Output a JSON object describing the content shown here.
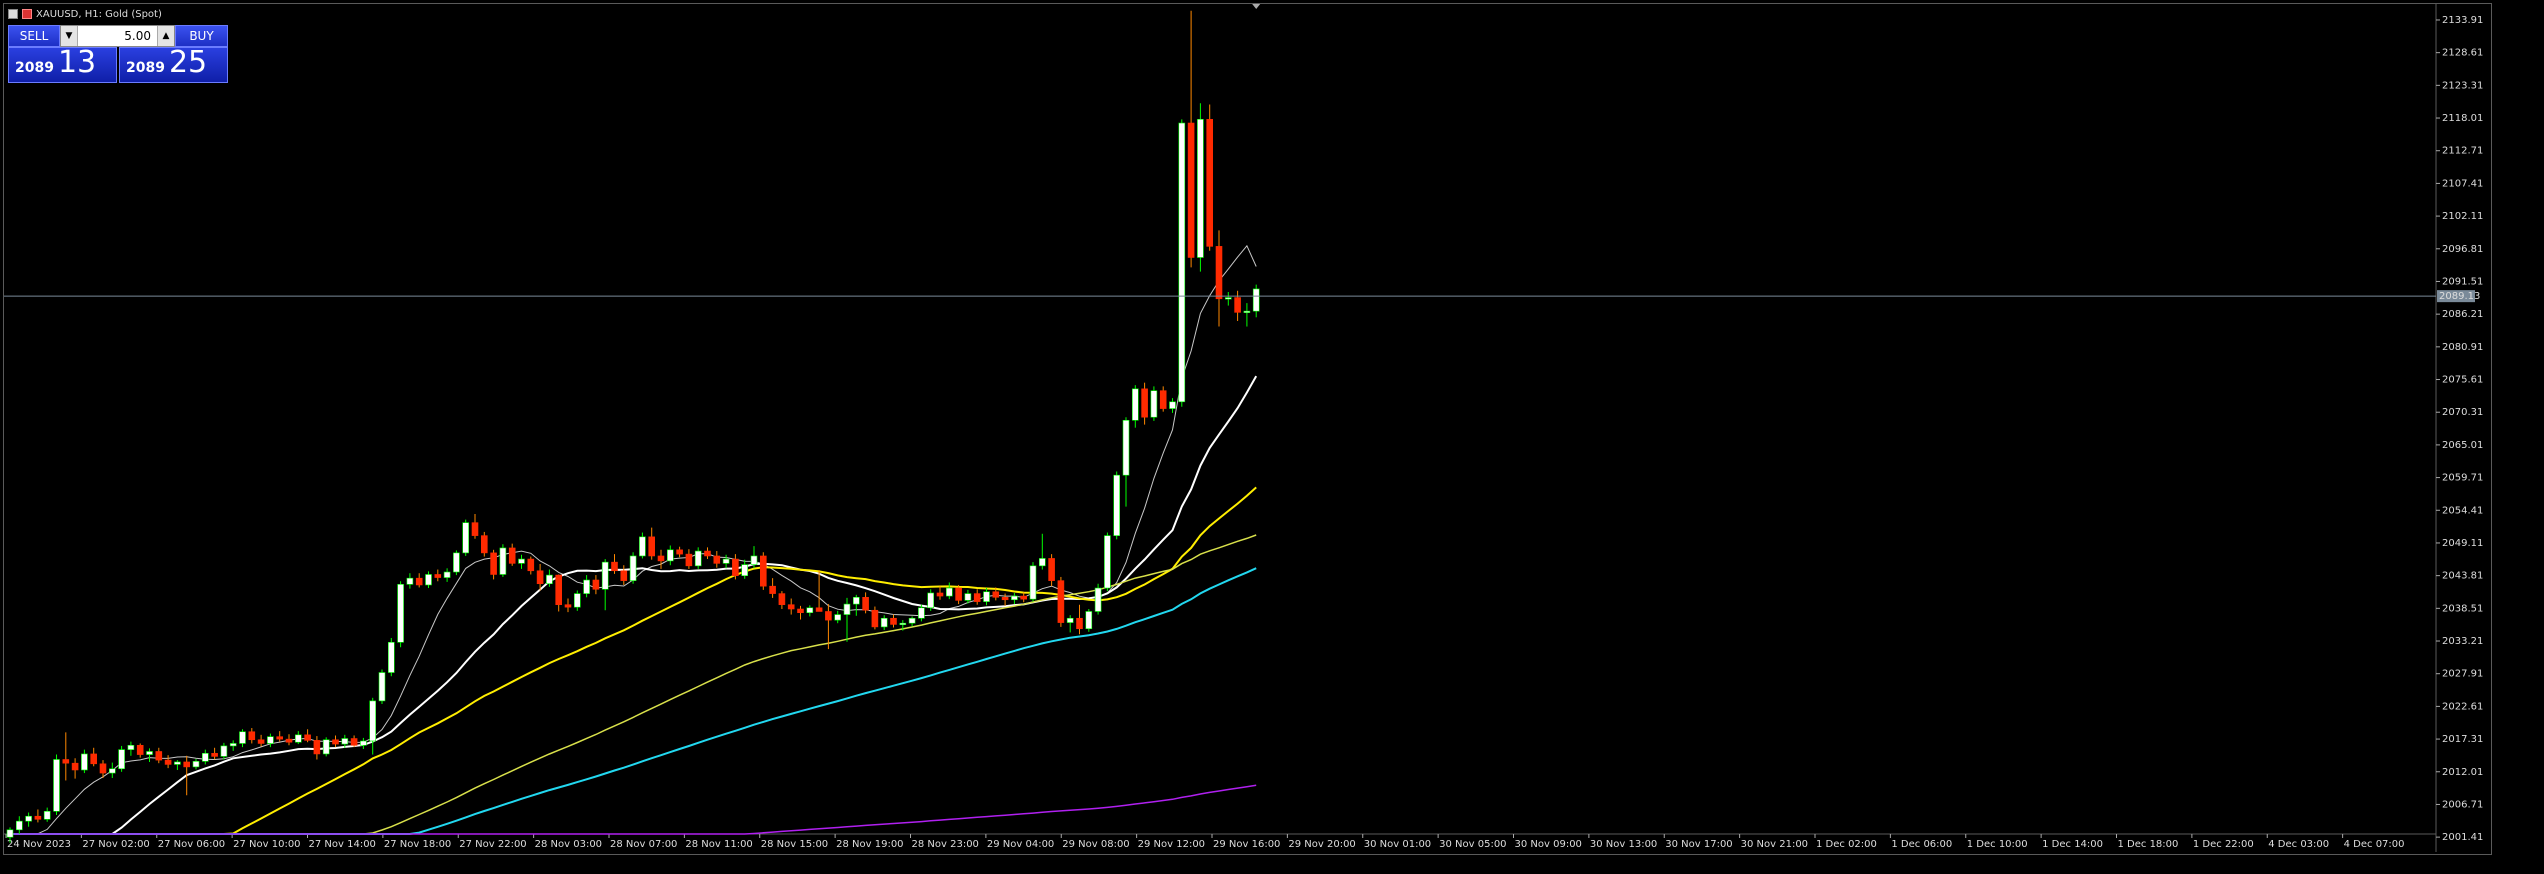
{
  "window": {
    "title": "XAUUSD, H1:  Gold (Spot)"
  },
  "trade_panel": {
    "sell_label": "SELL",
    "buy_label": "BUY",
    "lot": "5.00",
    "sell_price_small": "2089",
    "sell_price_big": "13",
    "buy_price_small": "2089",
    "buy_price_big": "25"
  },
  "colors": {
    "background": "#000000",
    "bull_body": "#ffffff",
    "bear_body": "#ff2a00",
    "wick_bull": "#00ff00",
    "wick_bear": "#ff8800",
    "ma_fast": "#c8c8c8",
    "ma_white": "#ffffff",
    "ma_yellow": "#ffee00",
    "ma_olive": "#d8e04a",
    "ma_cyan": "#22d8f0",
    "ma_purple": "#b020f0",
    "bid_line": "#7a8a99"
  },
  "chart_data": {
    "type": "candlestick",
    "symbol": "XAUUSD",
    "timeframe": "H1",
    "current_price_label": "2089.13",
    "current_price": 2089.13,
    "price_ticks": [
      "2133.91",
      "2128.61",
      "2123.31",
      "2118.01",
      "2112.71",
      "2107.41",
      "2102.11",
      "2096.81",
      "2091.51",
      "2086.21",
      "2080.91",
      "2075.61",
      "2070.31",
      "2065.01",
      "2059.71",
      "2054.41",
      "2049.11",
      "2043.81",
      "2038.51",
      "2033.21",
      "2027.91",
      "2022.61",
      "2017.31",
      "2012.01",
      "2006.71",
      "2001.41"
    ],
    "time_ticks": [
      "24 Nov 2023",
      "27 Nov 02:00",
      "27 Nov 06:00",
      "27 Nov 10:00",
      "27 Nov 14:00",
      "27 Nov 18:00",
      "27 Nov 22:00",
      "28 Nov 03:00",
      "28 Nov 07:00",
      "28 Nov 11:00",
      "28 Nov 15:00",
      "28 Nov 19:00",
      "28 Nov 23:00",
      "29 Nov 04:00",
      "29 Nov 08:00",
      "29 Nov 12:00",
      "29 Nov 16:00",
      "29 Nov 20:00",
      "30 Nov 01:00",
      "30 Nov 05:00",
      "30 Nov 09:00",
      "30 Nov 13:00",
      "30 Nov 17:00",
      "30 Nov 21:00",
      "1 Dec 02:00",
      "1 Dec 06:00",
      "1 Dec 10:00",
      "1 Dec 14:00",
      "1 Dec 18:00",
      "1 Dec 22:00",
      "4 Dec 03:00",
      "4 Dec 07:00"
    ],
    "ylim": [
      1999.0,
      2136.5
    ],
    "candles": [
      [
        2001.4,
        2003.0,
        2000.5,
        2002.6
      ],
      [
        2002.6,
        2004.8,
        2001.9,
        2004.0
      ],
      [
        2004.0,
        2005.4,
        2003.1,
        2004.8
      ],
      [
        2004.8,
        2005.9,
        2003.8,
        2004.3
      ],
      [
        2004.3,
        2006.2,
        2003.9,
        2005.6
      ],
      [
        2005.6,
        2014.8,
        2005.0,
        2014.0
      ],
      [
        2014.0,
        2018.4,
        2010.6,
        2013.4
      ],
      [
        2013.4,
        2014.2,
        2010.9,
        2012.3
      ],
      [
        2012.3,
        2015.6,
        2011.8,
        2014.9
      ],
      [
        2014.9,
        2015.9,
        2012.9,
        2013.3
      ],
      [
        2013.3,
        2013.9,
        2011.0,
        2011.8
      ],
      [
        2011.8,
        2013.5,
        2011.0,
        2012.5
      ],
      [
        2012.5,
        2016.2,
        2012.0,
        2015.6
      ],
      [
        2015.6,
        2016.9,
        2014.6,
        2016.3
      ],
      [
        2016.3,
        2016.6,
        2014.3,
        2014.8
      ],
      [
        2014.8,
        2015.8,
        2013.6,
        2015.3
      ],
      [
        2015.3,
        2015.9,
        2013.4,
        2013.9
      ],
      [
        2013.9,
        2014.7,
        2012.6,
        2013.2
      ],
      [
        2013.2,
        2013.9,
        2012.3,
        2013.6
      ],
      [
        2013.6,
        2014.6,
        2008.2,
        2012.8
      ],
      [
        2012.8,
        2014.1,
        2012.4,
        2013.7
      ],
      [
        2013.7,
        2015.6,
        2013.2,
        2015.0
      ],
      [
        2015.0,
        2015.9,
        2014.0,
        2014.5
      ],
      [
        2014.5,
        2016.7,
        2014.0,
        2016.2
      ],
      [
        2016.2,
        2017.1,
        2015.4,
        2016.6
      ],
      [
        2016.6,
        2018.9,
        2016.0,
        2018.5
      ],
      [
        2018.5,
        2019.1,
        2016.6,
        2017.2
      ],
      [
        2017.2,
        2018.0,
        2016.1,
        2016.6
      ],
      [
        2016.6,
        2018.2,
        2016.0,
        2017.7
      ],
      [
        2017.7,
        2018.6,
        2016.9,
        2017.3
      ],
      [
        2017.3,
        2018.1,
        2016.3,
        2016.8
      ],
      [
        2016.8,
        2018.6,
        2016.5,
        2018.0
      ],
      [
        2018.0,
        2018.9,
        2016.8,
        2017.1
      ],
      [
        2017.1,
        2017.8,
        2014.0,
        2014.9
      ],
      [
        2014.9,
        2017.6,
        2014.5,
        2017.2
      ],
      [
        2017.2,
        2017.9,
        2016.0,
        2016.5
      ],
      [
        2016.5,
        2018.0,
        2015.9,
        2017.4
      ],
      [
        2017.4,
        2017.9,
        2016.0,
        2016.3
      ],
      [
        2016.3,
        2017.5,
        2015.7,
        2017.0
      ],
      [
        2017.0,
        2024.0,
        2014.8,
        2023.5
      ],
      [
        2023.5,
        2028.6,
        2023.0,
        2028.1
      ],
      [
        2028.1,
        2033.7,
        2027.5,
        2033.0
      ],
      [
        2033.0,
        2042.9,
        2032.2,
        2042.4
      ],
      [
        2042.4,
        2044.2,
        2041.7,
        2043.4
      ],
      [
        2043.4,
        2044.2,
        2041.9,
        2042.3
      ],
      [
        2042.3,
        2044.5,
        2041.8,
        2044.0
      ],
      [
        2044.0,
        2044.8,
        2042.9,
        2043.5
      ],
      [
        2043.5,
        2045.0,
        2042.8,
        2044.4
      ],
      [
        2044.4,
        2047.9,
        2043.9,
        2047.5
      ],
      [
        2047.5,
        2052.9,
        2047.0,
        2052.4
      ],
      [
        2052.4,
        2053.8,
        2049.8,
        2050.3
      ],
      [
        2050.3,
        2050.9,
        2046.9,
        2047.5
      ],
      [
        2047.5,
        2048.0,
        2043.2,
        2044.0
      ],
      [
        2044.0,
        2048.9,
        2043.6,
        2048.3
      ],
      [
        2048.3,
        2049.0,
        2045.4,
        2045.8
      ],
      [
        2045.8,
        2047.2,
        2044.9,
        2046.5
      ],
      [
        2046.5,
        2046.9,
        2044.0,
        2044.6
      ],
      [
        2044.6,
        2045.7,
        2041.4,
        2042.5
      ],
      [
        2042.5,
        2044.8,
        2042.0,
        2043.9
      ],
      [
        2043.9,
        2044.0,
        2038.0,
        2039.1
      ],
      [
        2039.1,
        2040.1,
        2037.9,
        2038.7
      ],
      [
        2038.7,
        2041.4,
        2038.1,
        2040.9
      ],
      [
        2040.9,
        2043.9,
        2040.3,
        2043.1
      ],
      [
        2043.1,
        2043.9,
        2040.8,
        2041.6
      ],
      [
        2041.6,
        2046.5,
        2038.2,
        2046.0
      ],
      [
        2046.0,
        2047.3,
        2044.1,
        2044.6
      ],
      [
        2044.6,
        2045.5,
        2042.3,
        2043.0
      ],
      [
        2043.0,
        2047.6,
        2042.5,
        2047.0
      ],
      [
        2047.0,
        2050.8,
        2046.6,
        2050.1
      ],
      [
        2050.1,
        2051.6,
        2046.4,
        2047.0
      ],
      [
        2047.0,
        2048.0,
        2044.9,
        2046.2
      ],
      [
        2046.2,
        2048.7,
        2045.5,
        2048.0
      ],
      [
        2048.0,
        2048.5,
        2046.8,
        2047.3
      ],
      [
        2047.3,
        2048.1,
        2044.9,
        2045.4
      ],
      [
        2045.4,
        2048.4,
        2044.9,
        2047.8
      ],
      [
        2047.8,
        2048.4,
        2046.5,
        2047.0
      ],
      [
        2047.0,
        2047.8,
        2045.1,
        2045.8
      ],
      [
        2045.8,
        2047.2,
        2045.0,
        2046.5
      ],
      [
        2046.5,
        2047.3,
        2043.2,
        2043.8
      ],
      [
        2043.8,
        2046.4,
        2043.3,
        2045.6
      ],
      [
        2045.6,
        2048.6,
        2045.0,
        2047.0
      ],
      [
        2047.0,
        2047.6,
        2041.5,
        2042.1
      ],
      [
        2042.1,
        2043.4,
        2040.2,
        2040.9
      ],
      [
        2040.9,
        2041.3,
        2038.4,
        2039.1
      ],
      [
        2039.1,
        2040.1,
        2037.5,
        2038.4
      ],
      [
        2038.4,
        2038.9,
        2036.7,
        2037.8
      ],
      [
        2037.8,
        2039.0,
        2037.2,
        2038.6
      ],
      [
        2038.6,
        2044.7,
        2038.0,
        2038.0
      ],
      [
        2038.0,
        2039.2,
        2031.9,
        2036.6
      ],
      [
        2036.6,
        2038.1,
        2036.1,
        2037.5
      ],
      [
        2037.5,
        2040.2,
        2033.1,
        2039.2
      ],
      [
        2039.2,
        2040.7,
        2037.3,
        2040.3
      ],
      [
        2040.3,
        2041.1,
        2037.7,
        2038.2
      ],
      [
        2038.2,
        2038.8,
        2035.1,
        2035.5
      ],
      [
        2035.5,
        2037.4,
        2035.0,
        2036.9
      ],
      [
        2036.9,
        2037.5,
        2035.4,
        2035.9
      ],
      [
        2035.9,
        2036.6,
        2034.9,
        2036.1
      ],
      [
        2036.1,
        2037.2,
        2035.6,
        2036.9
      ],
      [
        2036.9,
        2039.1,
        2036.4,
        2038.6
      ],
      [
        2038.6,
        2041.6,
        2038.1,
        2041.0
      ],
      [
        2041.0,
        2042.1,
        2039.9,
        2040.5
      ],
      [
        2040.5,
        2042.7,
        2040.0,
        2041.8
      ],
      [
        2041.8,
        2042.3,
        2039.2,
        2039.8
      ],
      [
        2039.8,
        2041.5,
        2039.3,
        2040.9
      ],
      [
        2040.9,
        2041.6,
        2039.1,
        2039.6
      ],
      [
        2039.6,
        2041.8,
        2039.0,
        2041.2
      ],
      [
        2041.2,
        2041.9,
        2039.8,
        2040.3
      ],
      [
        2040.3,
        2040.9,
        2038.9,
        2039.9
      ],
      [
        2039.9,
        2041.0,
        2039.2,
        2040.5
      ],
      [
        2040.5,
        2041.1,
        2039.5,
        2040.0
      ],
      [
        2040.0,
        2046.0,
        2039.6,
        2045.4
      ],
      [
        2045.4,
        2050.6,
        2044.8,
        2046.6
      ],
      [
        2046.6,
        2047.3,
        2042.1,
        2043.0
      ],
      [
        2043.0,
        2043.6,
        2035.5,
        2036.2
      ],
      [
        2036.2,
        2037.4,
        2034.6,
        2036.9
      ],
      [
        2036.9,
        2039.1,
        2034.3,
        2035.2
      ],
      [
        2035.2,
        2038.4,
        2034.7,
        2038.0
      ],
      [
        2038.0,
        2042.5,
        2037.5,
        2041.8
      ],
      [
        2041.8,
        2050.8,
        2041.3,
        2050.3
      ],
      [
        2050.3,
        2060.7,
        2049.7,
        2060.1
      ],
      [
        2060.1,
        2069.5,
        2055.0,
        2069.0
      ],
      [
        2069.0,
        2074.7,
        2067.8,
        2074.1
      ],
      [
        2074.1,
        2075.1,
        2068.3,
        2069.5
      ],
      [
        2069.5,
        2074.5,
        2068.9,
        2073.8
      ],
      [
        2073.8,
        2074.5,
        2070.4,
        2070.9
      ],
      [
        2070.9,
        2072.6,
        2070.2,
        2072.0
      ],
      [
        2072.0,
        2117.8,
        2071.2,
        2117.2
      ],
      [
        2117.2,
        2135.4,
        2093.8,
        2095.4
      ],
      [
        2095.4,
        2120.4,
        2093.1,
        2117.8
      ],
      [
        2117.8,
        2120.2,
        2096.5,
        2097.2
      ],
      [
        2097.2,
        2099.8,
        2084.2,
        2088.7
      ],
      [
        2088.7,
        2089.8,
        2087.6,
        2088.9
      ],
      [
        2088.9,
        2090.0,
        2085.1,
        2086.5
      ],
      [
        2086.5,
        2088.0,
        2084.2,
        2086.7
      ],
      [
        2086.7,
        2091.0,
        2085.7,
        2090.3
      ]
    ],
    "ma_count": 6,
    "ma_labels": [
      "MA fast",
      "MA white",
      "MA yellow",
      "MA olive",
      "MA cyan",
      "MA purple"
    ]
  }
}
